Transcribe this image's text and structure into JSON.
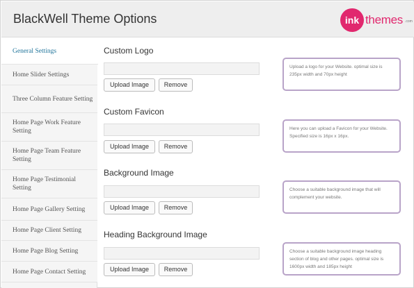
{
  "header": {
    "title": "BlackWell Theme Options",
    "logo": {
      "mark": "ink",
      "word": "themes",
      "suffix": ".com",
      "color": "#e1286e"
    }
  },
  "sidebar": {
    "items": [
      {
        "label": "General Settings",
        "active": true
      },
      {
        "label": "Home Slider Settings"
      },
      {
        "label": "Three Column Feature Setting"
      },
      {
        "label": "Home Page Work Feature Setting"
      },
      {
        "label": "Home Page Team Feature Setting"
      },
      {
        "label": "Home Page Testimonial Setting"
      },
      {
        "label": "Home Page Gallery Setting"
      },
      {
        "label": "Home Page Client Setting"
      },
      {
        "label": "Home Page Blog Setting"
      },
      {
        "label": "Home Page Contact Setting"
      }
    ]
  },
  "sections": [
    {
      "title": "Custom Logo",
      "input_value": "",
      "upload_label": "Upload Image",
      "remove_label": "Remove",
      "help": "Upload a logo for your Website. optimal size is 235px width and 70px height"
    },
    {
      "title": "Custom Favicon",
      "input_value": "",
      "upload_label": "Upload Image",
      "remove_label": "Remove",
      "help": "Here you can upload a Favicon for your Website. Specified size is 16px x 16px."
    },
    {
      "title": "Background Image",
      "input_value": "",
      "upload_label": "Upload Image",
      "remove_label": "Remove",
      "help": "Choose a suitable background image that will complement your website."
    },
    {
      "title": "Heading Background Image",
      "input_value": "",
      "upload_label": "Upload Image",
      "remove_label": "Remove",
      "help": "Choose a suitable background image heading section of blog and other pages. optimal size is 1600px width and 185px height"
    }
  ],
  "colors": {
    "accent": "#21759b",
    "help_border": "#b8a3c8",
    "brand": "#e1286e"
  }
}
